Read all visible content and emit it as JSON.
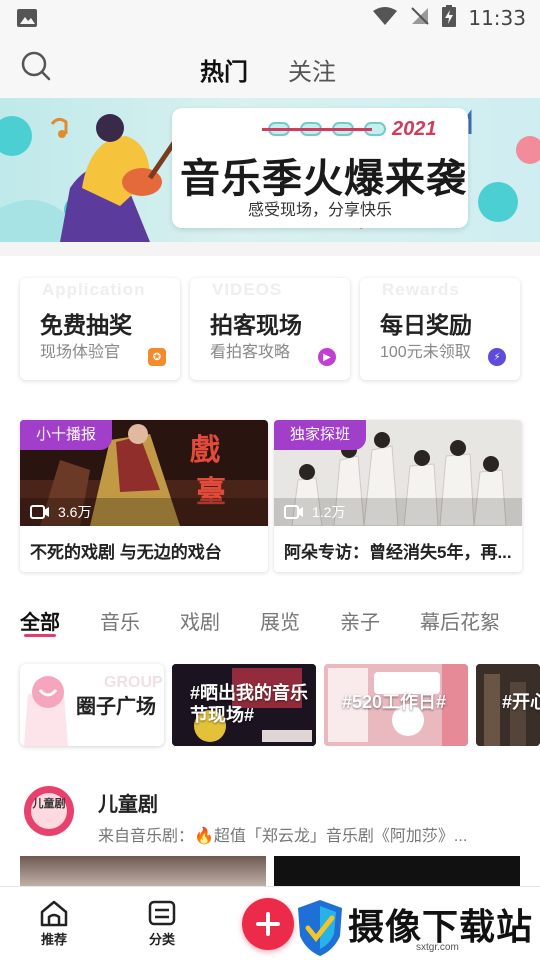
{
  "status_bar": {
    "time": "11:33"
  },
  "header": {
    "tabs": [
      {
        "label": "热门"
      },
      {
        "label": "关注"
      }
    ]
  },
  "banner": {
    "title": "音乐季火爆来袭",
    "year": "2021",
    "subtitle": "感受现场，分享快乐"
  },
  "quick_cards": [
    {
      "bg_text": "Application",
      "title": "免费抽奖",
      "subtitle": "现场体验官",
      "badge_color": "#f58a2b"
    },
    {
      "bg_text": "VIDEOS",
      "title": "拍客现场",
      "subtitle": "看拍客攻略",
      "badge_color": "#c13fd2"
    },
    {
      "bg_text": "Rewards",
      "title": "每日奖励",
      "subtitle": "100元未领取",
      "badge_color": "#5d4bdc"
    }
  ],
  "videos": [
    {
      "tag": "小十播报",
      "views": "3.6万",
      "title": "不死的戏剧 与无边的戏台"
    },
    {
      "tag": "独家探班",
      "views": "1.2万",
      "title": "阿朵专访：曾经消失5年，再..."
    }
  ],
  "categories": [
    {
      "label": "全部"
    },
    {
      "label": "音乐"
    },
    {
      "label": "戏剧"
    },
    {
      "label": "展览"
    },
    {
      "label": "亲子"
    },
    {
      "label": "幕后花絮"
    }
  ],
  "topics": {
    "square": {
      "ghost": "GROUP",
      "label": "圈子广场"
    },
    "tiles": [
      {
        "label": "#晒出我的音乐节现场#"
      },
      {
        "label": "#520工作日#"
      },
      {
        "label": "#开心"
      }
    ]
  },
  "article": {
    "avatar_text": "儿童剧",
    "title": "儿童剧",
    "subtitle": "来自音乐剧：🔥超值「郑云龙」音乐剧《阿加莎》..."
  },
  "bottom_nav": [
    {
      "label": "推荐"
    },
    {
      "label": "分类"
    }
  ],
  "watermark": {
    "text": "摄像下载站",
    "url": "sxtgr.com"
  }
}
